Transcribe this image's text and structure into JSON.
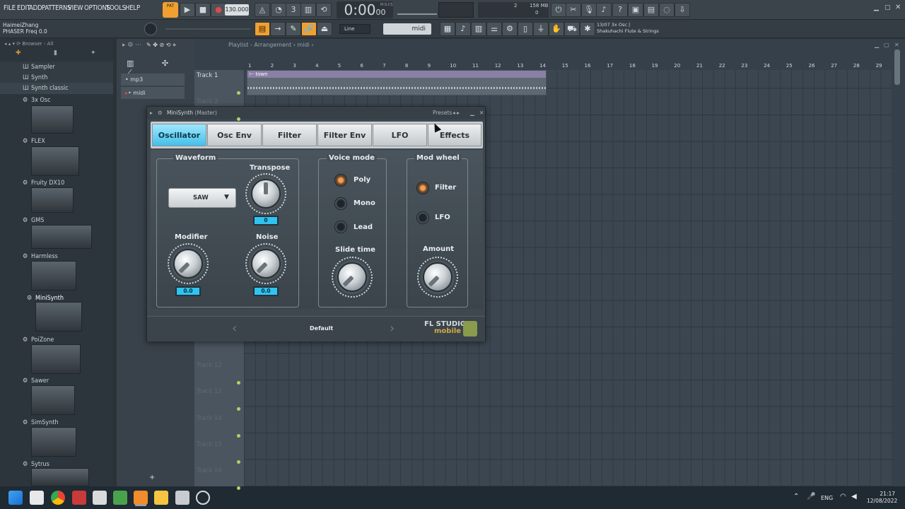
{
  "menu": [
    "FILE",
    "EDIT",
    "ADD",
    "PATTERNS",
    "VIEW",
    "OPTIONS",
    "TOOLS",
    "HELP"
  ],
  "transport": {
    "pat_label": "PAT",
    "song_label": "SONG",
    "tempo": "130.000",
    "time": "0:00",
    "time_small": "00",
    "msc_label": "M:S:CS"
  },
  "cpu": {
    "cpu_value": "2",
    "mem": "158 MB",
    "voices": "0"
  },
  "hint": {
    "line1": "HaimeiZhang",
    "line2": "PHASER Freq 0.0"
  },
  "snap": {
    "label": "Line",
    "pattern": "midi"
  },
  "plugin_info": {
    "line1": "13/07  3x Osc |",
    "line2": "Shakuhachi Flute & Strings"
  },
  "browser": {
    "title": "Browser - All",
    "items": [
      {
        "label": "Sampler"
      },
      {
        "label": "Synth"
      },
      {
        "label": "Synth classic"
      },
      {
        "label": "3x Osc"
      },
      {
        "label": "FLEX"
      },
      {
        "label": "Fruity DX10"
      },
      {
        "label": "GMS"
      },
      {
        "label": "Harmless"
      },
      {
        "label": "MiniSynth"
      },
      {
        "label": "PoiZone"
      },
      {
        "label": "Sawer"
      },
      {
        "label": "SimSynth"
      },
      {
        "label": "Sytrus"
      }
    ]
  },
  "channels": [
    {
      "label": "mp3"
    },
    {
      "label": "midi"
    }
  ],
  "playlist": {
    "title": "Playlist - Arrangement",
    "pattern": "midi",
    "bar_numbers": [
      "1",
      "2",
      "3",
      "4",
      "5",
      "6",
      "7",
      "8",
      "9",
      "10",
      "11",
      "12",
      "13",
      "14",
      "15",
      "16",
      "17",
      "18",
      "19",
      "20",
      "21",
      "22",
      "23",
      "24",
      "25",
      "26",
      "27",
      "28",
      "29"
    ],
    "clip_label": "town",
    "tracks": [
      "Track 1",
      "Track 2",
      "Track 12",
      "Track 13",
      "Track 14",
      "Track 15",
      "Track 16"
    ]
  },
  "minisynth": {
    "title": "MiniSynth",
    "title_sub": "(Master)",
    "presets_label": "Presets",
    "tabs": [
      "Oscillator",
      "Osc Env",
      "Filter",
      "Filter Env",
      "LFO",
      "Effects"
    ],
    "waveform": {
      "label": "Waveform",
      "value": "SAW"
    },
    "transpose": {
      "label": "Transpose",
      "value": "0"
    },
    "modifier": {
      "label": "Modifier",
      "value": "0.0"
    },
    "noise": {
      "label": "Noise",
      "value": "0.0"
    },
    "voice_mode": {
      "label": "Voice mode",
      "options": [
        "Poly",
        "Mono",
        "Lead"
      ],
      "selected": "Poly"
    },
    "slide_time": {
      "label": "Slide time"
    },
    "mod_wheel": {
      "label": "Mod wheel",
      "options": [
        "Filter",
        "LFO"
      ],
      "selected": "Filter"
    },
    "amount": {
      "label": "Amount"
    },
    "preset_name": "Default",
    "logo_line1": "FL STUDIO",
    "logo_line2": "mobile"
  },
  "taskbar": {
    "lang": "ENG",
    "time": "21:17",
    "date": "12/08/2022"
  }
}
